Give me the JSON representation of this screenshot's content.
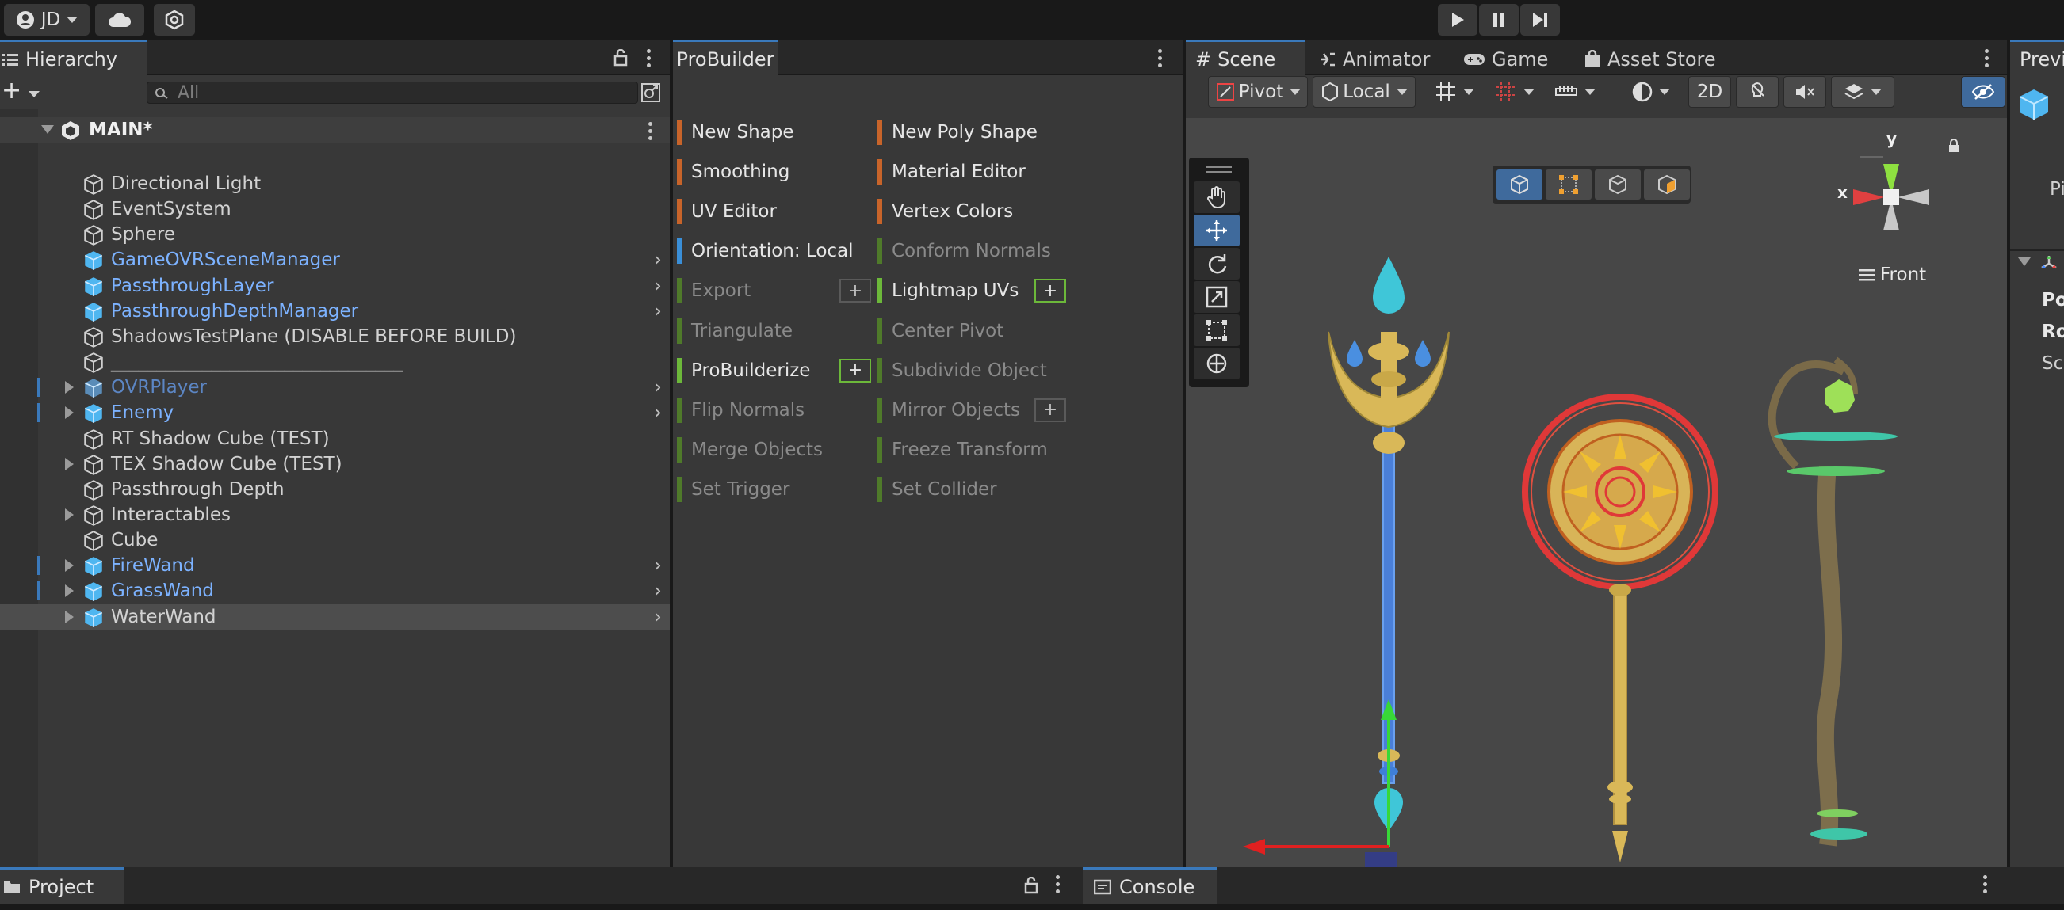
{
  "topbar": {
    "account": "JD"
  },
  "hierarchy": {
    "tab": "Hierarchy",
    "search_placeholder": "All",
    "scene_name": "MAIN*",
    "items": [
      {
        "label": "Directional Light"
      },
      {
        "label": "EventSystem"
      },
      {
        "label": "Sphere"
      },
      {
        "label": "GameOVRSceneManager"
      },
      {
        "label": "PassthroughLayer"
      },
      {
        "label": "PassthroughDepthManager"
      },
      {
        "label": "ShadowsTestPlane (DISABLE BEFORE BUILD)"
      },
      {
        "label": "________________________________"
      },
      {
        "label": "OVRPlayer"
      },
      {
        "label": "Enemy"
      },
      {
        "label": "RT Shadow Cube (TEST)"
      },
      {
        "label": "TEX Shadow Cube (TEST)"
      },
      {
        "label": "Passthrough Depth"
      },
      {
        "label": "Interactables"
      },
      {
        "label": "Cube"
      },
      {
        "label": "FireWand"
      },
      {
        "label": "GrassWand"
      },
      {
        "label": "WaterWand"
      }
    ]
  },
  "probuilder": {
    "tab": "ProBuilder",
    "left": [
      {
        "label": "New Shape"
      },
      {
        "label": "Smoothing"
      },
      {
        "label": "UV Editor"
      },
      {
        "label": "Orientation: Local"
      },
      {
        "label": "Export",
        "plus": "+"
      },
      {
        "label": "Triangulate"
      },
      {
        "label": "ProBuilderize",
        "plus": "+"
      },
      {
        "label": "Flip Normals"
      },
      {
        "label": "Merge Objects"
      },
      {
        "label": "Set Trigger"
      }
    ],
    "right": [
      {
        "label": "New Poly Shape"
      },
      {
        "label": "Material Editor"
      },
      {
        "label": "Vertex Colors"
      },
      {
        "label": "Conform Normals"
      },
      {
        "label": "Lightmap UVs",
        "plus": "+"
      },
      {
        "label": "Center Pivot"
      },
      {
        "label": "Subdivide Object"
      },
      {
        "label": "Mirror Objects",
        "plus": "+"
      },
      {
        "label": "Freeze Transform"
      },
      {
        "label": "Set Collider"
      }
    ]
  },
  "scene": {
    "tabs": [
      {
        "label": "Scene"
      },
      {
        "label": "Animator"
      },
      {
        "label": "Game"
      },
      {
        "label": "Asset Store"
      }
    ],
    "pivot": "Pivot",
    "local": "Local",
    "mode_2d": "2D",
    "view_label": "Front",
    "axis_y": "y",
    "axis_x": "x"
  },
  "inspector": {
    "tab": "Previ",
    "rows": [
      "Po",
      "Ro",
      "Sc"
    ],
    "side_label": "Pi"
  },
  "bottom": {
    "project_tab": "Project",
    "console_tab": "Console"
  }
}
